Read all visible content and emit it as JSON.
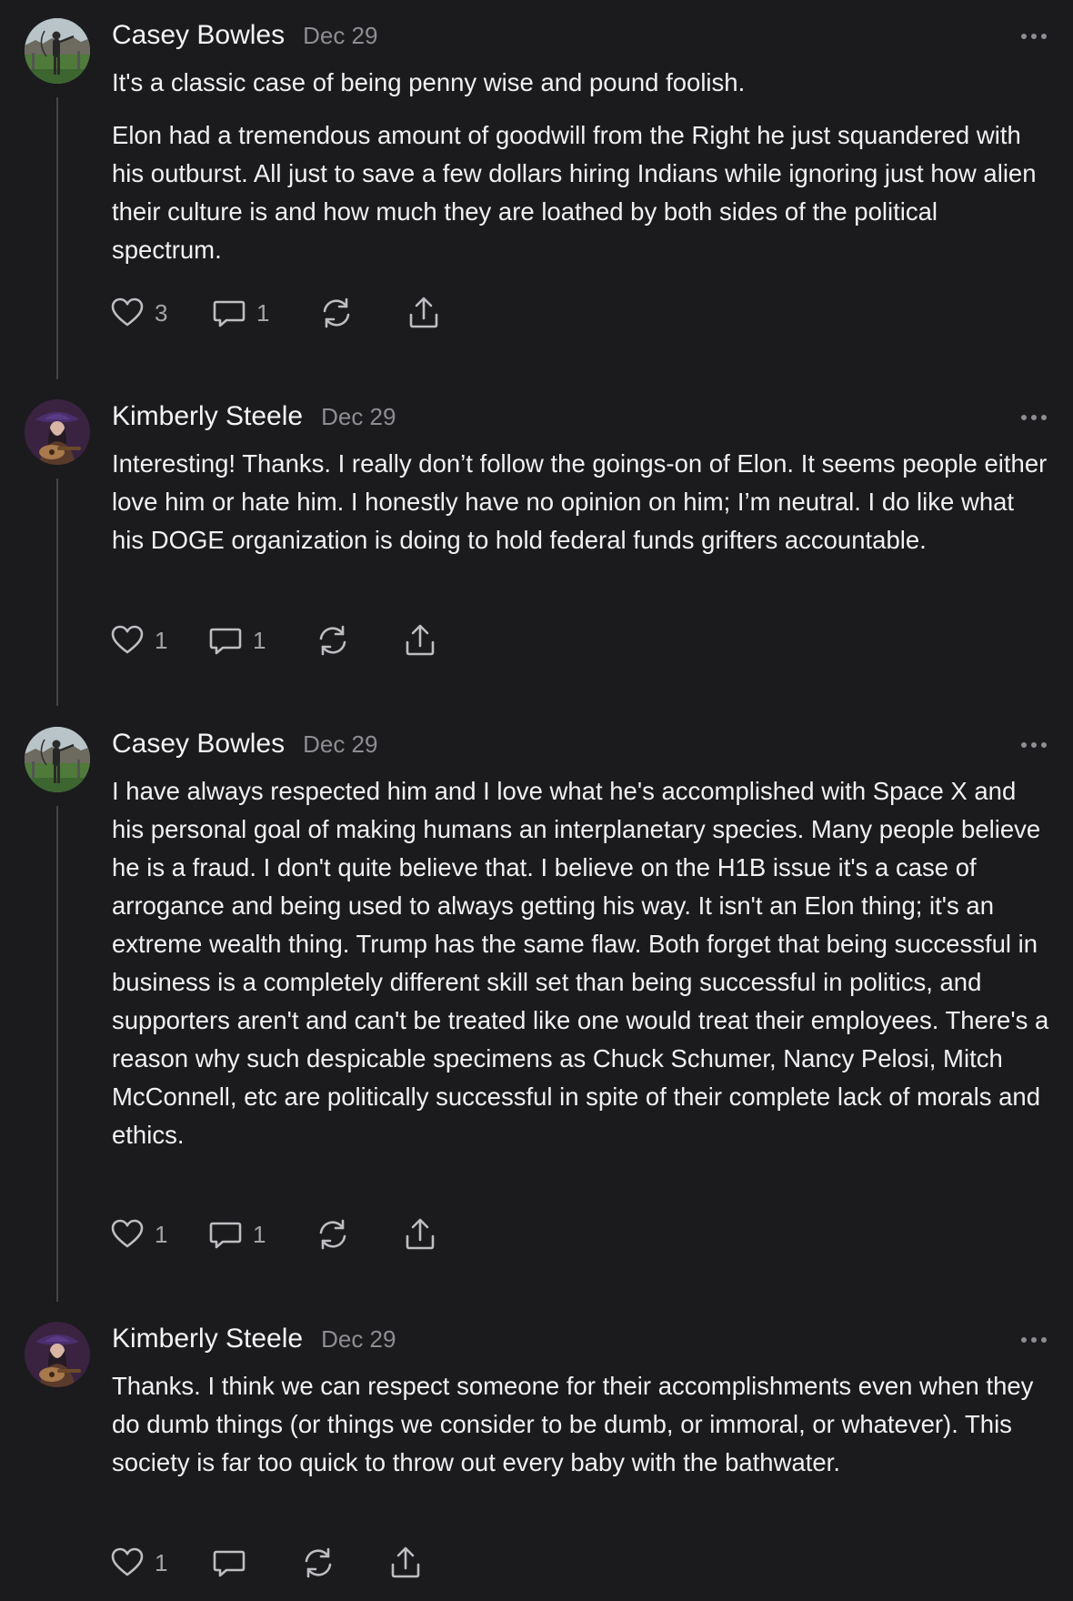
{
  "colors": {
    "background": "#1b1b1d",
    "text": "#f1f1f3",
    "muted": "#8d8d93",
    "thread_line": "#444448",
    "icon": "#bdbdc2"
  },
  "comments": [
    {
      "author": "Casey Bowles",
      "date": "Dec 29",
      "avatar": "archer-avatar",
      "paragraphs": [
        "It's a classic case of being penny wise and pound foolish.",
        "Elon had a tremendous amount of goodwill from the Right he just squandered with his outburst. All just to save a few dollars hiring Indians while ignoring just how alien their culture is and how much they are loathed by both sides of the political spectrum."
      ],
      "likes": "3",
      "replies": "1",
      "icons": [
        "heart-icon",
        "comment-icon",
        "restack-icon",
        "share-icon",
        "more-icon"
      ]
    },
    {
      "author": "Kimberly Steele",
      "date": "Dec 29",
      "avatar": "guitarist-avatar",
      "paragraphs": [
        "Interesting! Thanks. I really don’t follow the goings-on of Elon. It seems people either love him or hate him. I honestly have no opinion on him; I’m neutral. I do like what his DOGE organization is doing to hold federal funds grifters accountable."
      ],
      "likes": "1",
      "replies": "1",
      "icons": [
        "heart-icon",
        "comment-icon",
        "restack-icon",
        "share-icon",
        "more-icon"
      ]
    },
    {
      "author": "Casey Bowles",
      "date": "Dec 29",
      "avatar": "archer-avatar",
      "paragraphs": [
        "I have always respected him and I love what he's accomplished with Space X and his personal goal of making humans an interplanetary species. Many people believe he is a fraud. I don't quite believe that. I believe on the H1B issue it's a case of arrogance and being used to always getting his way. It isn't an Elon thing; it's an extreme wealth thing. Trump has the same flaw. Both forget that being successful in business is a completely different skill set than being successful in politics, and supporters aren't and can't be treated like one would treat their employees. There's a reason why such despicable specimens as Chuck Schumer, Nancy Pelosi, Mitch McConnell, etc are politically successful in spite of their complete lack of morals and ethics."
      ],
      "likes": "1",
      "replies": "1",
      "icons": [
        "heart-icon",
        "comment-icon",
        "restack-icon",
        "share-icon",
        "more-icon"
      ]
    },
    {
      "author": "Kimberly Steele",
      "date": "Dec 29",
      "avatar": "guitarist-avatar",
      "paragraphs": [
        "Thanks. I think we can respect someone for their accomplishments even when they do dumb things (or things we consider to be dumb, or immoral, or whatever). This society is far too quick to throw out every baby with the bathwater."
      ],
      "likes": "1",
      "replies": "",
      "icons": [
        "heart-icon",
        "comment-icon",
        "restack-icon",
        "share-icon",
        "more-icon"
      ]
    }
  ]
}
